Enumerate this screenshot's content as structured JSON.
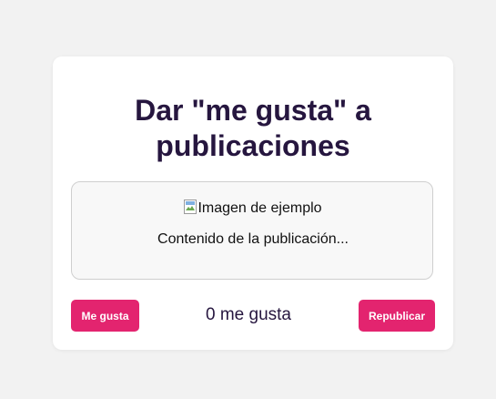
{
  "card": {
    "title": "Dar \"me gusta\" a publicaciones"
  },
  "post": {
    "image_alt": "Imagen de ejemplo",
    "content": "Contenido de la publicación..."
  },
  "actions": {
    "like_label": "Me gusta",
    "like_count_text": "0 me gusta",
    "repost_label": "Republicar"
  },
  "colors": {
    "accent": "#e3246f",
    "title": "#26163f",
    "background": "#f2f2f2"
  },
  "icons": {
    "image_placeholder": "broken-image-icon"
  }
}
